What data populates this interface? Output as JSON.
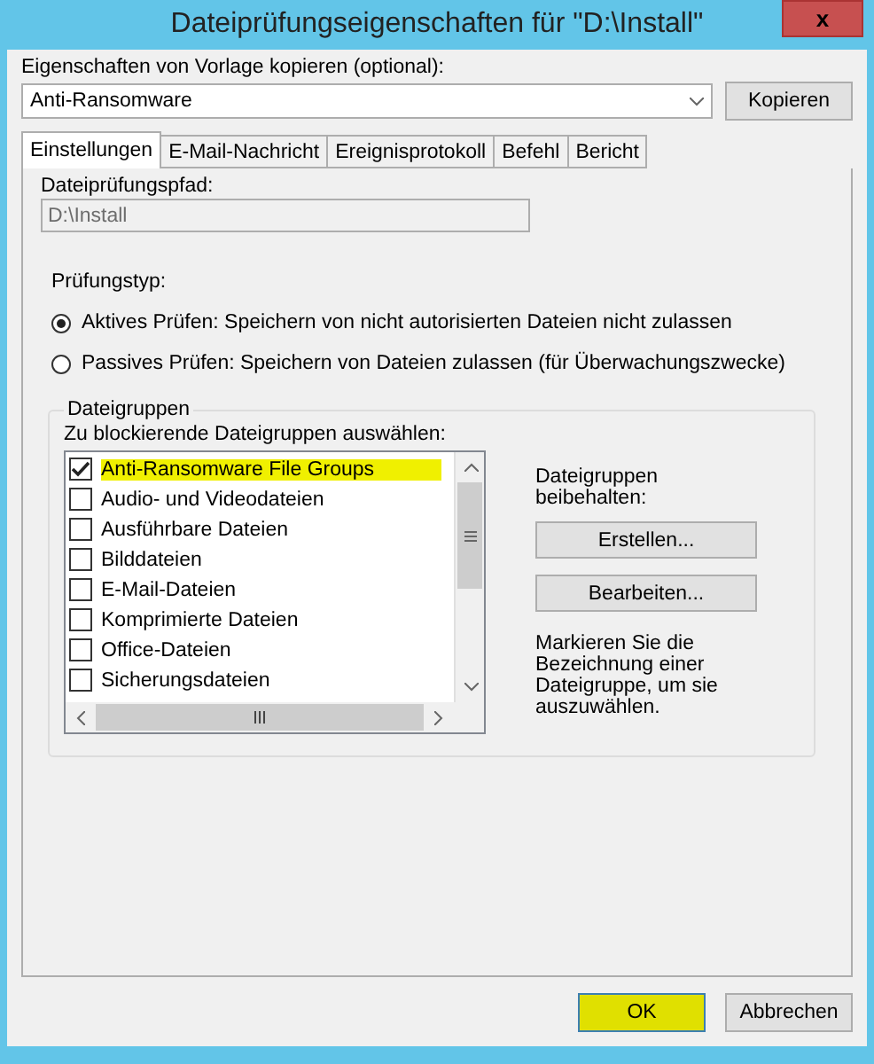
{
  "window": {
    "title": "Dateiprüfungseigenschaften für \"D:\\Install\"",
    "close": "x"
  },
  "template": {
    "label": "Eigenschaften von Vorlage kopieren (optional):",
    "value": "Anti-Ransomware",
    "button": "Kopieren"
  },
  "tabs": [
    {
      "label": "Einstellungen",
      "selected": true
    },
    {
      "label": "E-Mail-Nachricht",
      "selected": false
    },
    {
      "label": "Ereignisprotokoll",
      "selected": false
    },
    {
      "label": "Befehl",
      "selected": false
    },
    {
      "label": "Bericht",
      "selected": false
    }
  ],
  "path": {
    "label": "Dateiprüfungspfad:",
    "value": "D:\\Install",
    "disabled": true
  },
  "screening_type": {
    "label": "Prüfungstyp:",
    "options": [
      {
        "label": "Aktives Prüfen: Speichern von nicht autorisierten Dateien nicht zulassen",
        "selected": true
      },
      {
        "label": "Passives Prüfen: Speichern von Dateien zulassen (für Überwachungszwecke)",
        "selected": false
      }
    ]
  },
  "file_groups": {
    "title": "Dateigruppen",
    "list_label": "Zu blockierende Dateigruppen auswählen:",
    "items": [
      {
        "label": "Anti-Ransomware File Groups",
        "checked": true,
        "highlighted": true
      },
      {
        "label": "Audio- und Videodateien",
        "checked": false,
        "highlighted": false
      },
      {
        "label": "Ausführbare Dateien",
        "checked": false,
        "highlighted": false
      },
      {
        "label": "Bilddateien",
        "checked": false,
        "highlighted": false
      },
      {
        "label": "E-Mail-Dateien",
        "checked": false,
        "highlighted": false
      },
      {
        "label": "Komprimierte Dateien",
        "checked": false,
        "highlighted": false
      },
      {
        "label": "Office-Dateien",
        "checked": false,
        "highlighted": false
      },
      {
        "label": "Sicherungsdateien",
        "checked": false,
        "highlighted": false
      }
    ],
    "manage_label": "Dateigruppen beibehalten:",
    "buttons": [
      "Erstellen...",
      "Bearbeiten..."
    ],
    "hint": "Markieren Sie die Bezeichnung einer Dateigruppe, um sie auszuwählen."
  },
  "footer": {
    "buttons": [
      {
        "label": "OK",
        "highlighted": true
      },
      {
        "label": "Abbrechen",
        "highlighted": false
      }
    ]
  }
}
